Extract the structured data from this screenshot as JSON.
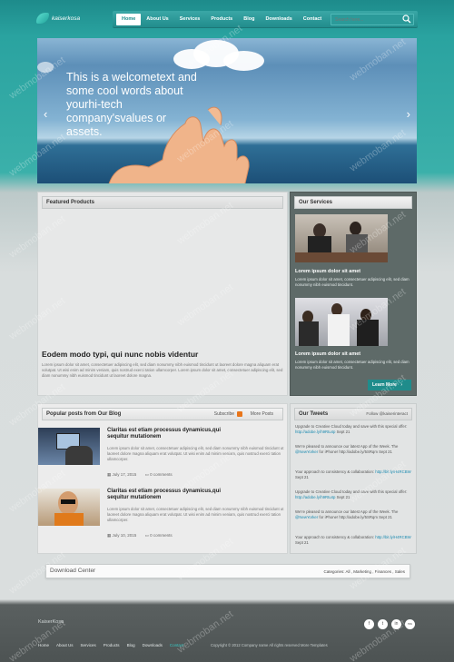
{
  "header": {
    "logo_text": "kaiserkosa",
    "nav": [
      "Home",
      "About Us",
      "Services",
      "Products",
      "Blog",
      "Downloads",
      "Contact"
    ],
    "active_nav": "Home",
    "search_placeholder": "Search here..."
  },
  "hero": {
    "text": "This is a welcometext and some cool words about yourhi-tech company'svalues or assets.",
    "prev": "‹",
    "next": "›"
  },
  "featured": {
    "title": "Featured Products",
    "heading": "Eodem modo typi, qui nunc nobis videntur",
    "body": "Lorem ipsum dolor sit amet, consectetuer adipiscing elit, sed diam nonummy nibh euismod tincidunt ut laoreet dolore magna aliquam erat volutpat. Ut wisi enim ad minim veniam, quis nostrud exerci tation ullamcorper. Lorem ipsum dolor sit amet, consectetuer adipiscing elit, sed diam nonummy nibh euismod tincidunt ut laoreet dolore magna."
  },
  "services": {
    "title": "Our Services",
    "items": [
      {
        "heading": "Lorem ipsum dolor sit amet",
        "body": "Lorem ipsum dolor sit amet, consectetuer adipiscing elit, sed diam nonummy nibh euismod tincidunt."
      },
      {
        "heading": "Lorem ipsum dolor sit amet",
        "body": "Lorem ipsum dolor sit amet, consectetuer adipiscing elit, sed diam nonummy nibh euismod tincidunt."
      }
    ],
    "button": "Learn More"
  },
  "blog": {
    "title": "Popular posts from Our Blog",
    "subscribe": "Subscribe",
    "more": "More Posts",
    "posts": [
      {
        "title": "Claritas est etiam processus dynamicus,qui sequitur mutationem",
        "body": "Lorem ipsum dolor sit amet, consectetuer adipiscing elit, sed diam nonummy nibh euismod tincidunt ut laoreet dolore magna aliquam erat volutpat. Ut wisi enim ad minim veniam, quis nostrud exerci tation ullamcorper.",
        "date": "July 17, 2015",
        "comments": "0 comments"
      },
      {
        "title": "Claritas est etiam processus dynamicus,qui sequitur mutationem",
        "body": "Lorem ipsum dolor sit amet, consectetuer adipiscing elit, sed diam nonummy nibh euismod tincidunt ut laoreet dolore magna aliquam erat volutpat. Ut wisi enim ad minim veniam, quis nostrud exerci tation ullamcorper.",
        "date": "July 10, 2015",
        "comments": "0 comments"
      }
    ]
  },
  "tweets": {
    "title": "Our Tweets",
    "follow": "Follow @kaiserinteract",
    "items": [
      {
        "text": "Upgrade to Creative Cloud today and save with this special offer: ",
        "link": "http://adobe.ly/h9Rtu4p",
        "tail": " Sept 21"
      },
      {
        "text": "We're pleased to announce our latest App of the Week. The ",
        "link": "@NewYorker",
        "tail": " for iPhone! http://adobe.ly/5SRqm Sept 21"
      },
      {
        "text": "Your approach to consistency & collaboration: ",
        "link": "http://bit.ly/H4RCBW",
        "tail": " Sept 21"
      },
      {
        "text": "Upgrade to Creative Cloud today and save with this special offer: ",
        "link": "http://adobe.ly/h9Rtu4p",
        "tail": " Sept 21"
      },
      {
        "text": "We're pleased to announce our latest App of the Week. The ",
        "link": "@NewYorker",
        "tail": " for iPhone! http://adobe.ly/5SRqm Sept 21"
      },
      {
        "text": "Your approach to consistency & collaboration: ",
        "link": "http://bit.ly/H4RCBW",
        "tail": " Sept 21"
      }
    ]
  },
  "download": {
    "title": "Download Center",
    "categories": "Categories: All , Marketing , Finances , Sales"
  },
  "footer": {
    "brand": "KaiserKosa",
    "social": [
      "f",
      "t",
      "in",
      "rss"
    ],
    "nav": [
      "Home",
      "About Us",
      "Services",
      "Products",
      "Blog",
      "Downloads",
      "Contact"
    ],
    "active_nav": "Contact",
    "copyright": "Copyright © 2012 Company name All rights reserved More Templates"
  },
  "watermark": "webmoban.net",
  "colors": {
    "accent": "#1f8c8b",
    "link": "#1a8ab0"
  }
}
